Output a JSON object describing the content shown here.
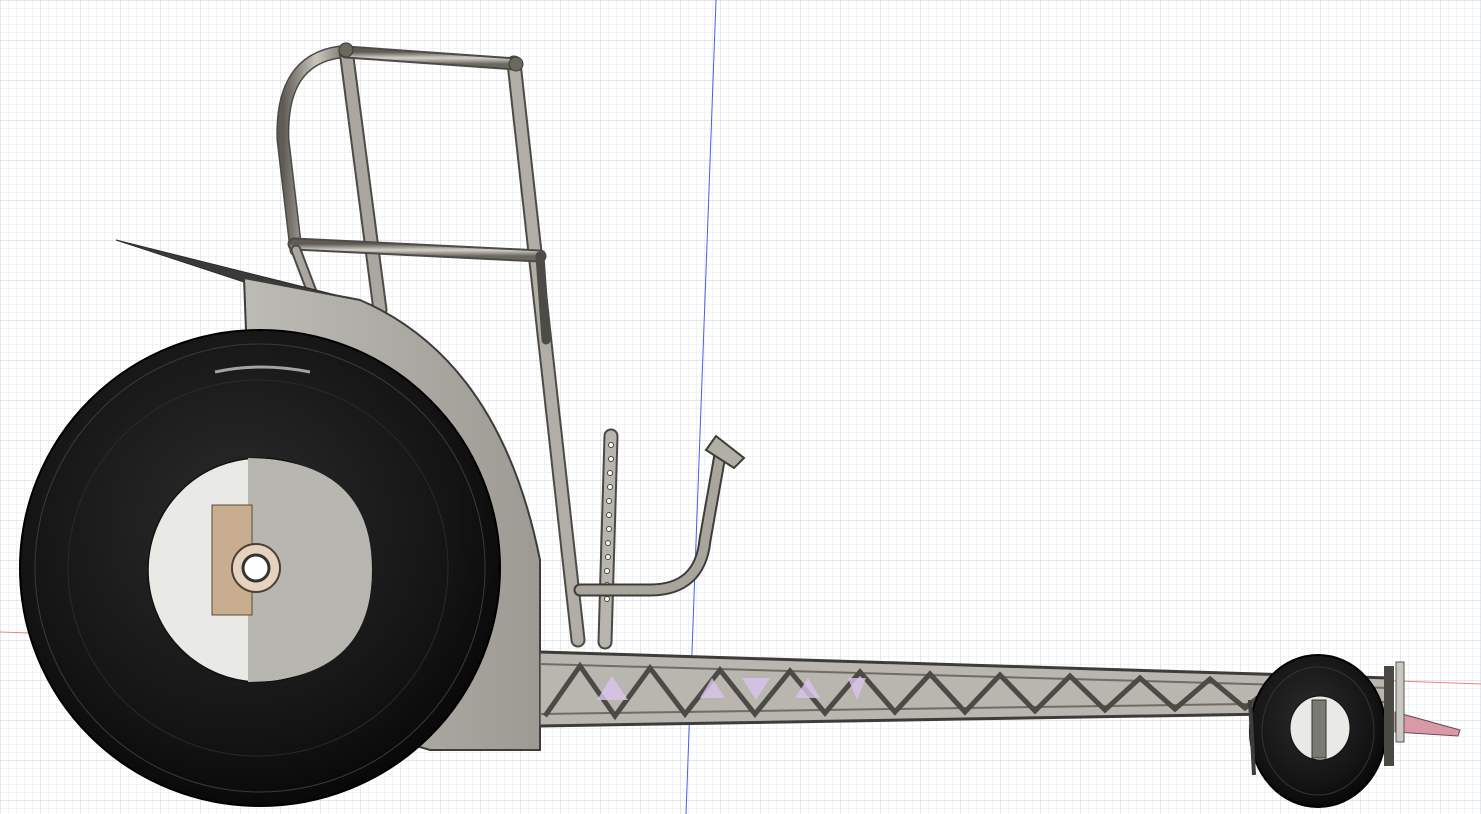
{
  "viewport": {
    "background": "#ffffff",
    "grid_minor_color": "#e3e8ee",
    "grid_major_color": "#c9d2dc",
    "axis_vertical_color": "#4a5ee8",
    "axis_horizontal_color": "#f08080"
  },
  "model": {
    "tire_color": "#151515",
    "tube_color": "#8f8d82",
    "panel_color": "#b9b7b1",
    "hub_color": "#c8ad8f",
    "highlight_color": "#dcc4ee",
    "wing_color": "#d99aa8"
  }
}
